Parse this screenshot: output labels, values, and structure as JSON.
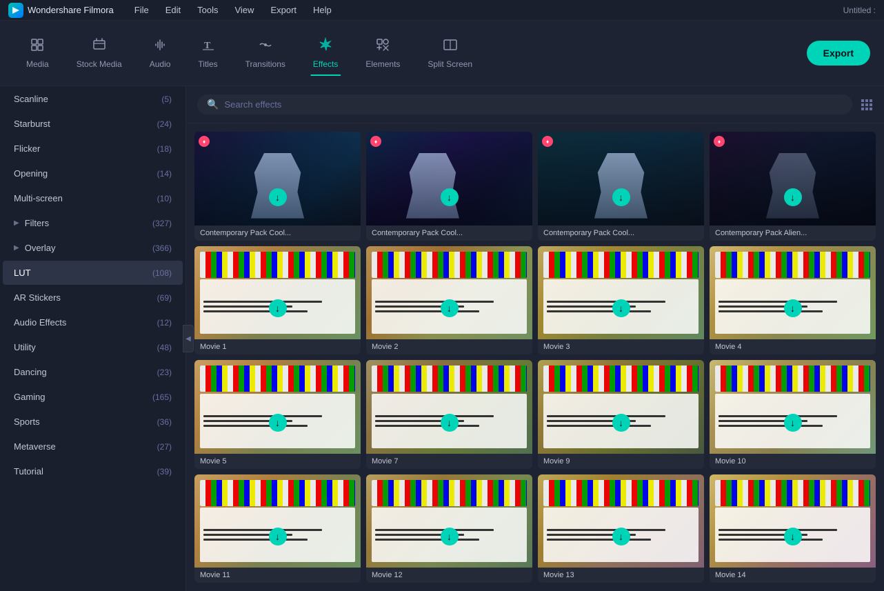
{
  "app": {
    "name": "Wondershare Filmora",
    "title_right": "Untitled :"
  },
  "menubar": {
    "items": [
      "File",
      "Edit",
      "Tools",
      "View",
      "Export",
      "Help"
    ]
  },
  "toolbar": {
    "items": [
      {
        "id": "media",
        "label": "Media",
        "icon": "☐",
        "active": false
      },
      {
        "id": "stock-media",
        "label": "Stock Media",
        "icon": "♪",
        "active": false
      },
      {
        "id": "audio",
        "label": "Audio",
        "icon": "♪",
        "active": false
      },
      {
        "id": "titles",
        "label": "Titles",
        "icon": "T",
        "active": false
      },
      {
        "id": "transitions",
        "label": "Transitions",
        "icon": "⬡",
        "active": false
      },
      {
        "id": "effects",
        "label": "Effects",
        "icon": "✦",
        "active": true
      },
      {
        "id": "elements",
        "label": "Elements",
        "icon": "⬡",
        "active": false
      },
      {
        "id": "split-screen",
        "label": "Split Screen",
        "icon": "▤",
        "active": false
      }
    ],
    "export_label": "Export"
  },
  "sidebar": {
    "items": [
      {
        "id": "scanline",
        "label": "Scanline",
        "count": "(5)",
        "expandable": false,
        "active": false
      },
      {
        "id": "starburst",
        "label": "Starburst",
        "count": "(24)",
        "expandable": false,
        "active": false
      },
      {
        "id": "flicker",
        "label": "Flicker",
        "count": "(18)",
        "expandable": false,
        "active": false
      },
      {
        "id": "opening",
        "label": "Opening",
        "count": "(14)",
        "expandable": false,
        "active": false
      },
      {
        "id": "multi-screen",
        "label": "Multi-screen",
        "count": "(10)",
        "expandable": false,
        "active": false
      },
      {
        "id": "filters",
        "label": "Filters",
        "count": "(327)",
        "expandable": true,
        "active": false
      },
      {
        "id": "overlay",
        "label": "Overlay",
        "count": "(366)",
        "expandable": true,
        "active": false
      },
      {
        "id": "lut",
        "label": "LUT",
        "count": "(108)",
        "expandable": false,
        "active": true
      },
      {
        "id": "ar-stickers",
        "label": "AR Stickers",
        "count": "(69)",
        "expandable": false,
        "active": false
      },
      {
        "id": "audio-effects",
        "label": "Audio Effects",
        "count": "(12)",
        "expandable": false,
        "active": false
      },
      {
        "id": "utility",
        "label": "Utility",
        "count": "(48)",
        "expandable": false,
        "active": false
      },
      {
        "id": "dancing",
        "label": "Dancing",
        "count": "(23)",
        "expandable": false,
        "active": false
      },
      {
        "id": "gaming",
        "label": "Gaming",
        "count": "(165)",
        "expandable": false,
        "active": false
      },
      {
        "id": "sports",
        "label": "Sports",
        "count": "(36)",
        "expandable": false,
        "active": false
      },
      {
        "id": "metaverse",
        "label": "Metaverse",
        "count": "(27)",
        "expandable": false,
        "active": false
      },
      {
        "id": "tutorial",
        "label": "Tutorial",
        "count": "(39)",
        "expandable": false,
        "active": false
      }
    ]
  },
  "search": {
    "placeholder": "Search effects"
  },
  "effects": {
    "items": [
      {
        "id": "contemporary-1",
        "label": "Contemporary Pack Cool...",
        "type": "contemporary",
        "premium": true
      },
      {
        "id": "contemporary-2",
        "label": "Contemporary Pack Cool...",
        "type": "contemporary",
        "premium": true
      },
      {
        "id": "contemporary-3",
        "label": "Contemporary Pack Cool...",
        "type": "contemporary",
        "premium": true
      },
      {
        "id": "contemporary-4",
        "label": "Contemporary Pack Alien...",
        "type": "contemporary",
        "premium": true
      },
      {
        "id": "movie-1",
        "label": "Movie 1",
        "type": "movie",
        "premium": false
      },
      {
        "id": "movie-2",
        "label": "Movie 2",
        "type": "movie",
        "premium": false
      },
      {
        "id": "movie-3",
        "label": "Movie 3",
        "type": "movie",
        "premium": false
      },
      {
        "id": "movie-4",
        "label": "Movie 4",
        "type": "movie",
        "premium": false
      },
      {
        "id": "movie-5",
        "label": "Movie 5",
        "type": "movie",
        "premium": false
      },
      {
        "id": "movie-7",
        "label": "Movie 7",
        "type": "movie",
        "premium": false
      },
      {
        "id": "movie-9",
        "label": "Movie 9",
        "type": "movie",
        "premium": false
      },
      {
        "id": "movie-10",
        "label": "Movie 10",
        "type": "movie",
        "premium": false
      },
      {
        "id": "movie-11",
        "label": "Movie 11",
        "type": "movie",
        "premium": false
      },
      {
        "id": "movie-12",
        "label": "Movie 12",
        "type": "movie",
        "premium": false
      },
      {
        "id": "movie-13",
        "label": "Movie 13",
        "type": "movie",
        "premium": false
      },
      {
        "id": "movie-14",
        "label": "Movie 14",
        "type": "movie",
        "premium": false
      }
    ]
  },
  "colors": {
    "accent": "#00d4b8",
    "premium_badge": "#ff4570",
    "active_sidebar": "#2e3448",
    "bg_dark": "#1a1f2e",
    "bg_medium": "#1e2333"
  }
}
